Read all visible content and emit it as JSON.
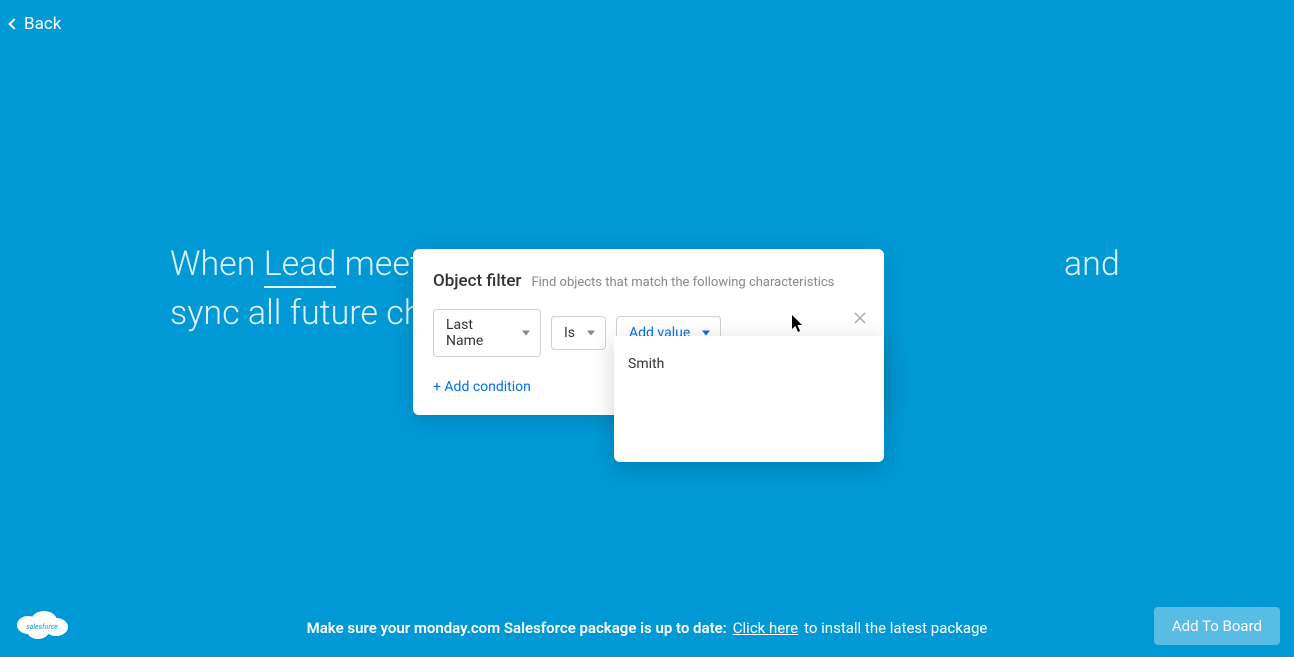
{
  "header": {
    "back_label": "Back"
  },
  "sentence": {
    "prefix": "When ",
    "lead_word": "Lead",
    "mid1": " meet",
    "mid2": "and sync all future changes fr"
  },
  "filter_panel": {
    "title": "Object filter",
    "subtitle": "Find objects that match the following characteristics",
    "field_dropdown": "Last Name",
    "operator_dropdown": "Is",
    "value_dropdown": "Add value",
    "add_condition_label": "+ Add condition"
  },
  "value_options": {
    "item1": "Smith"
  },
  "footer": {
    "bold_text": "Make sure your monday.com Salesforce package is up to date:",
    "link_text": "Click here",
    "trail_text": "to install the latest package"
  },
  "buttons": {
    "add_to_board": "Add To Board"
  }
}
